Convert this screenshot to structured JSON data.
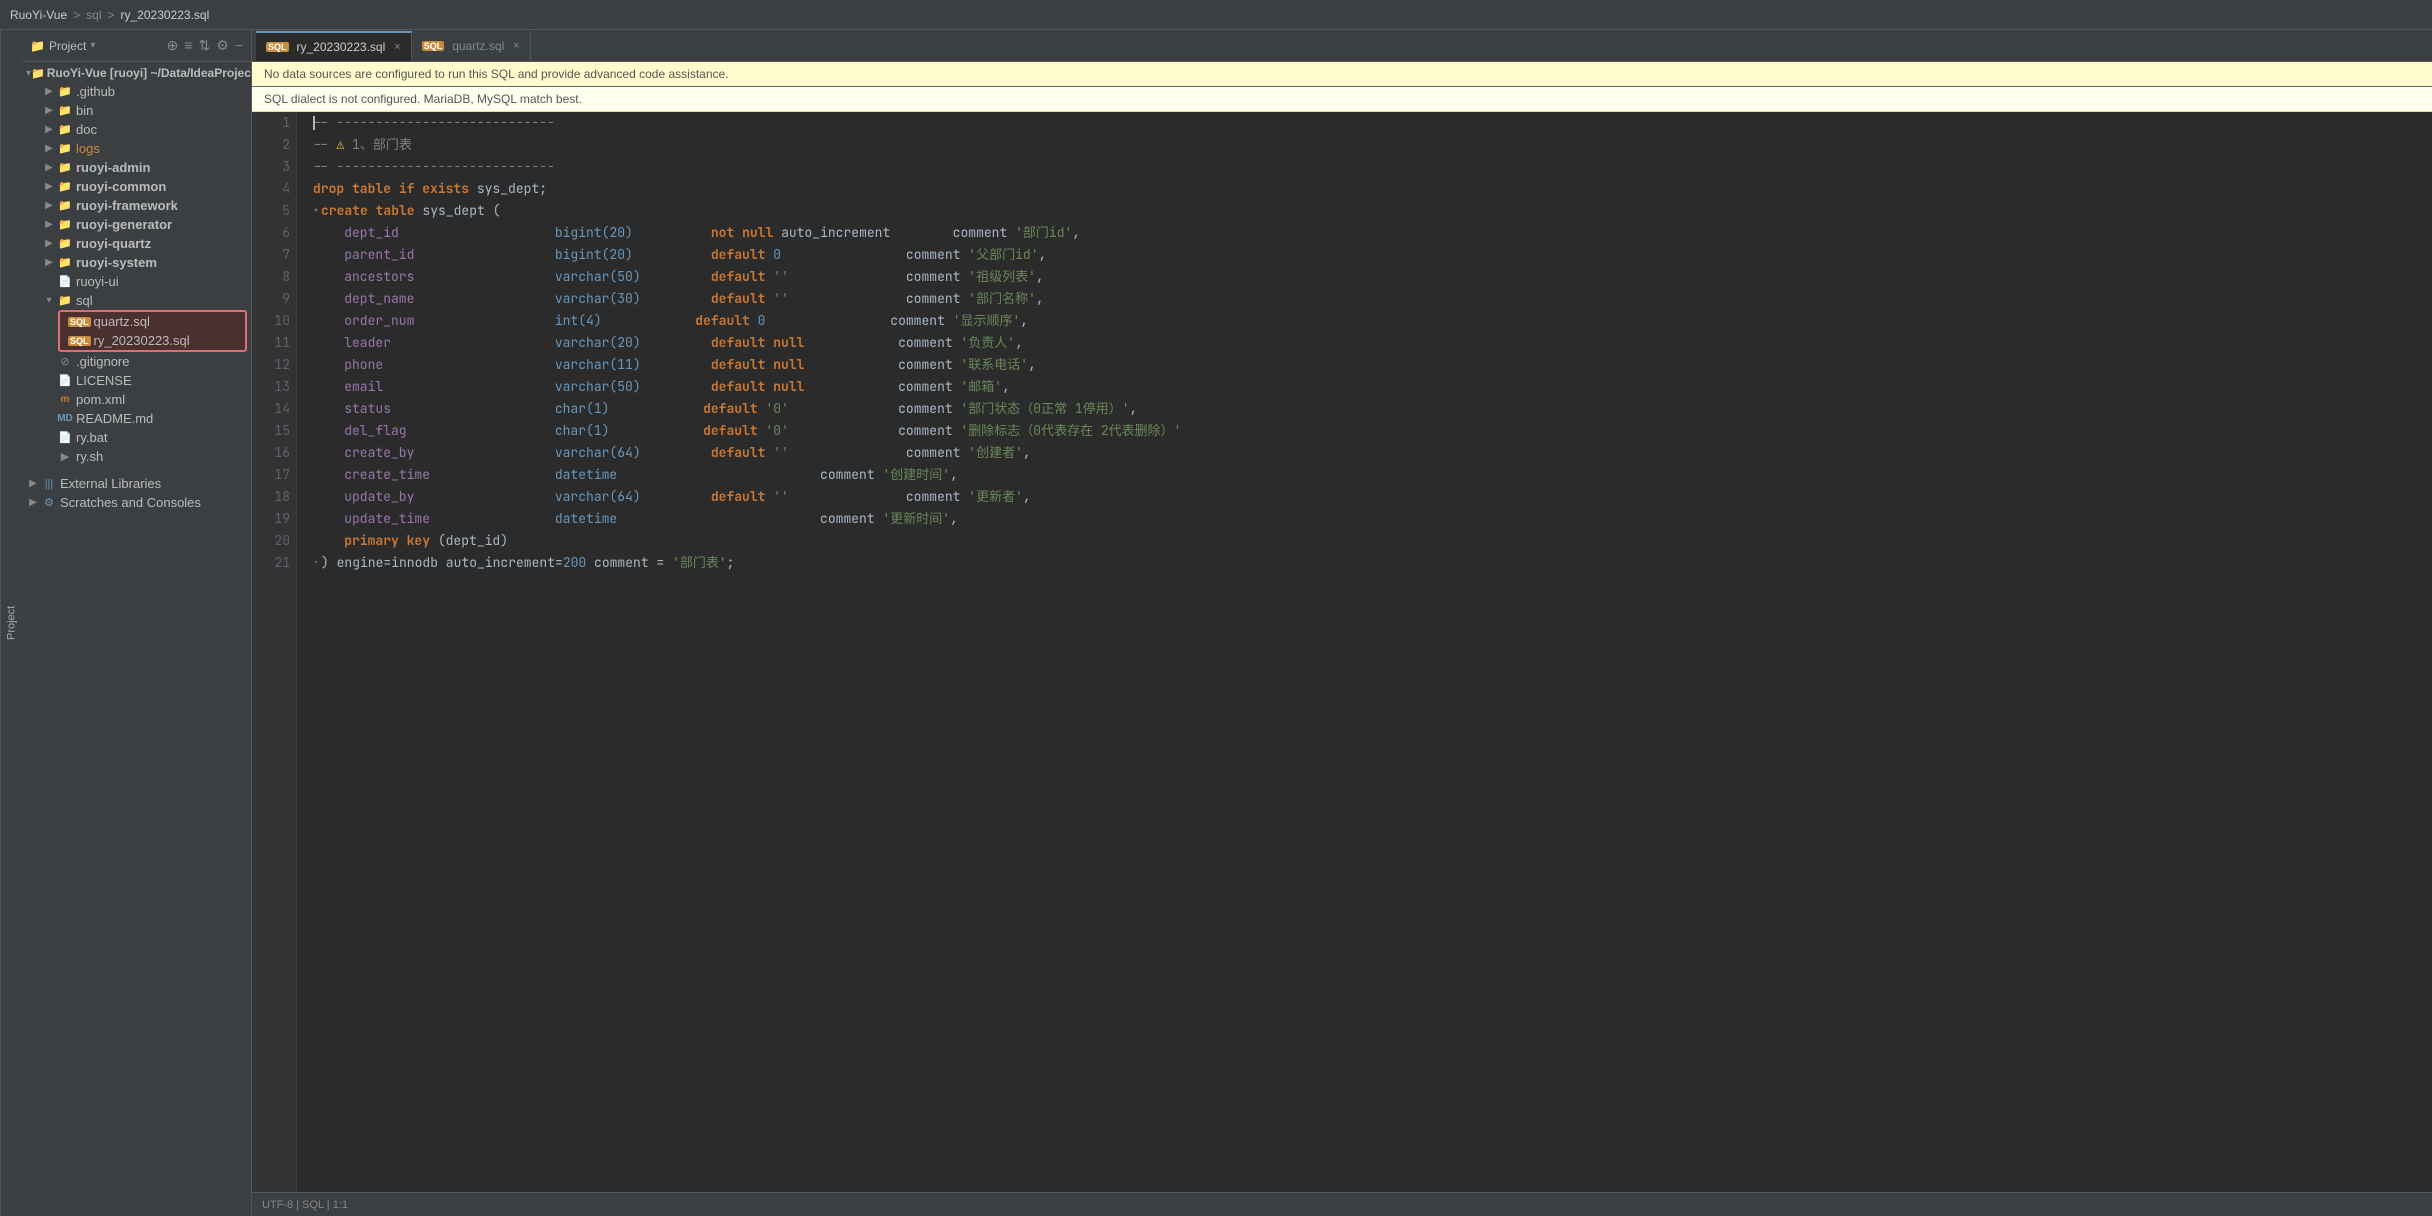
{
  "titlebar": {
    "project": "RuoYi-Vue",
    "sep1": ">",
    "folder": "sql",
    "sep2": ">",
    "file": "ry_20230223.sql"
  },
  "tabs": [
    {
      "id": "ry",
      "label": "ry_20230223.sql",
      "active": true,
      "icon": "SQL"
    },
    {
      "id": "quartz",
      "label": "quartz.sql",
      "active": false,
      "icon": "SQL"
    }
  ],
  "warnings": [
    {
      "id": "datasource",
      "text": "No data sources are configured to run this SQL and provide advanced code assistance."
    },
    {
      "id": "dialect",
      "text": "SQL dialect is not configured. MariaDB, MySQL match best."
    }
  ],
  "sidebar": {
    "title": "Project",
    "root": "RuoYi-Vue [ruoyi] ~/Data/IdeaProjects/RuoYi-V",
    "items": [
      {
        "id": "github",
        "label": ".github",
        "type": "folder",
        "depth": 1,
        "collapsed": true
      },
      {
        "id": "bin",
        "label": "bin",
        "type": "folder",
        "depth": 1,
        "collapsed": true
      },
      {
        "id": "doc",
        "label": "doc",
        "type": "folder",
        "depth": 1,
        "collapsed": true
      },
      {
        "id": "logs",
        "label": "logs",
        "type": "folder",
        "depth": 1,
        "collapsed": true,
        "orange": true
      },
      {
        "id": "ruoyi-admin",
        "label": "ruoyi-admin",
        "type": "folder",
        "depth": 1,
        "collapsed": true,
        "bold": true
      },
      {
        "id": "ruoyi-common",
        "label": "ruoyi-common",
        "type": "folder",
        "depth": 1,
        "collapsed": true,
        "bold": true
      },
      {
        "id": "ruoyi-framework",
        "label": "ruoyi-framework",
        "type": "folder",
        "depth": 1,
        "collapsed": true,
        "bold": true
      },
      {
        "id": "ruoyi-generator",
        "label": "ruoyi-generator",
        "type": "folder",
        "depth": 1,
        "collapsed": true,
        "bold": true
      },
      {
        "id": "ruoyi-quartz",
        "label": "ruoyi-quartz",
        "type": "folder",
        "depth": 1,
        "collapsed": true,
        "bold": true
      },
      {
        "id": "ruoyi-system",
        "label": "ruoyi-system",
        "type": "folder",
        "depth": 1,
        "collapsed": true,
        "bold": true
      },
      {
        "id": "ruoyi-ui",
        "label": "ruoyi-ui",
        "type": "item",
        "depth": 1,
        "collapsed": true
      },
      {
        "id": "sql",
        "label": "sql",
        "type": "folder",
        "depth": 1,
        "collapsed": false
      },
      {
        "id": "quartz-sql",
        "label": "quartz.sql",
        "type": "sql",
        "depth": 2,
        "selected": true
      },
      {
        "id": "ry-sql",
        "label": "ry_20230223.sql",
        "type": "sql",
        "depth": 2,
        "selected": true
      },
      {
        "id": "gitignore",
        "label": ".gitignore",
        "type": "gitignore",
        "depth": 1
      },
      {
        "id": "license",
        "label": "LICENSE",
        "type": "license",
        "depth": 1
      },
      {
        "id": "pom",
        "label": "pom.xml",
        "type": "xml",
        "depth": 1
      },
      {
        "id": "readme",
        "label": "README.md",
        "type": "md",
        "depth": 1
      },
      {
        "id": "ry-bat",
        "label": "ry.bat",
        "type": "bat",
        "depth": 1
      },
      {
        "id": "ry-sh",
        "label": "ry.sh",
        "type": "sh",
        "depth": 1
      }
    ],
    "external_libraries": "External Libraries",
    "scratches": "Scratches and Consoles"
  },
  "code_lines": [
    {
      "num": 1,
      "tokens": [
        {
          "t": "-- ----------------------------",
          "c": "comment"
        }
      ]
    },
    {
      "num": 2,
      "tokens": [
        {
          "t": "-- ",
          "c": "comment"
        },
        {
          "t": "⚠",
          "c": "warn-icon"
        },
        {
          "t": " 1、部门表",
          "c": "comment"
        }
      ]
    },
    {
      "num": 3,
      "tokens": [
        {
          "t": "-- ----------------------------",
          "c": "comment"
        }
      ]
    },
    {
      "num": 4,
      "tokens": [
        {
          "t": "drop table ",
          "c": "kw"
        },
        {
          "t": "if exists ",
          "c": "kw2"
        },
        {
          "t": "sys_dept;",
          "c": "plain"
        }
      ]
    },
    {
      "num": 5,
      "tokens": [
        {
          "t": "create table ",
          "c": "kw"
        },
        {
          "t": "sys_dept (",
          "c": "plain"
        }
      ]
    },
    {
      "num": 6,
      "tokens": [
        {
          "t": "    dept_id",
          "c": "col"
        },
        {
          "t": "                    ",
          "c": "plain"
        },
        {
          "t": "bigint(",
          "c": "type"
        },
        {
          "t": "20",
          "c": "num"
        },
        {
          "t": ")",
          "c": "type"
        },
        {
          "t": "          ",
          "c": "plain"
        },
        {
          "t": "not null ",
          "c": "kw"
        },
        {
          "t": "auto_increment",
          "c": "plain"
        },
        {
          "t": "        comment ",
          "c": "plain"
        },
        {
          "t": "'部门id'",
          "c": "str"
        },
        {
          "t": ",",
          "c": "plain"
        }
      ]
    },
    {
      "num": 7,
      "tokens": [
        {
          "t": "    parent_id",
          "c": "col"
        },
        {
          "t": "                  ",
          "c": "plain"
        },
        {
          "t": "bigint(",
          "c": "type"
        },
        {
          "t": "20",
          "c": "num"
        },
        {
          "t": ")",
          "c": "type"
        },
        {
          "t": "          ",
          "c": "plain"
        },
        {
          "t": "default ",
          "c": "kw"
        },
        {
          "t": "0",
          "c": "num"
        },
        {
          "t": "                ",
          "c": "plain"
        },
        {
          "t": "comment ",
          "c": "plain"
        },
        {
          "t": "'父部门id'",
          "c": "str"
        },
        {
          "t": ",",
          "c": "plain"
        }
      ]
    },
    {
      "num": 8,
      "tokens": [
        {
          "t": "    ancestors",
          "c": "col"
        },
        {
          "t": "                  ",
          "c": "plain"
        },
        {
          "t": "varchar(",
          "c": "type"
        },
        {
          "t": "50",
          "c": "num"
        },
        {
          "t": ")",
          "c": "type"
        },
        {
          "t": "         ",
          "c": "plain"
        },
        {
          "t": "default ",
          "c": "kw"
        },
        {
          "t": "''",
          "c": "str"
        },
        {
          "t": "               ",
          "c": "plain"
        },
        {
          "t": "comment ",
          "c": "plain"
        },
        {
          "t": "'祖级列表'",
          "c": "str"
        },
        {
          "t": ",",
          "c": "plain"
        }
      ]
    },
    {
      "num": 9,
      "tokens": [
        {
          "t": "    dept_name",
          "c": "col"
        },
        {
          "t": "                  ",
          "c": "plain"
        },
        {
          "t": "varchar(",
          "c": "type"
        },
        {
          "t": "30",
          "c": "num"
        },
        {
          "t": ")",
          "c": "type"
        },
        {
          "t": "         ",
          "c": "plain"
        },
        {
          "t": "default ",
          "c": "kw"
        },
        {
          "t": "''",
          "c": "str"
        },
        {
          "t": "               ",
          "c": "plain"
        },
        {
          "t": "comment ",
          "c": "plain"
        },
        {
          "t": "'部门名称'",
          "c": "str"
        },
        {
          "t": ",",
          "c": "plain"
        }
      ]
    },
    {
      "num": 10,
      "tokens": [
        {
          "t": "    order_num",
          "c": "col"
        },
        {
          "t": "                  ",
          "c": "plain"
        },
        {
          "t": "int(",
          "c": "type"
        },
        {
          "t": "4",
          "c": "num"
        },
        {
          "t": ")",
          "c": "type"
        },
        {
          "t": "            ",
          "c": "plain"
        },
        {
          "t": "default ",
          "c": "kw"
        },
        {
          "t": "0",
          "c": "num"
        },
        {
          "t": "                ",
          "c": "plain"
        },
        {
          "t": "comment ",
          "c": "plain"
        },
        {
          "t": "'显示顺序'",
          "c": "str"
        },
        {
          "t": ",",
          "c": "plain"
        }
      ]
    },
    {
      "num": 11,
      "tokens": [
        {
          "t": "    leader",
          "c": "col"
        },
        {
          "t": "                     ",
          "c": "plain"
        },
        {
          "t": "varchar(",
          "c": "type"
        },
        {
          "t": "20",
          "c": "num"
        },
        {
          "t": ")",
          "c": "type"
        },
        {
          "t": "         ",
          "c": "plain"
        },
        {
          "t": "default null",
          "c": "kw"
        },
        {
          "t": "            ",
          "c": "plain"
        },
        {
          "t": "comment ",
          "c": "plain"
        },
        {
          "t": "'负责人'",
          "c": "str"
        },
        {
          "t": ",",
          "c": "plain"
        }
      ]
    },
    {
      "num": 12,
      "tokens": [
        {
          "t": "    phone",
          "c": "col"
        },
        {
          "t": "                      ",
          "c": "plain"
        },
        {
          "t": "varchar(",
          "c": "type"
        },
        {
          "t": "11",
          "c": "num"
        },
        {
          "t": ")",
          "c": "type"
        },
        {
          "t": "         ",
          "c": "plain"
        },
        {
          "t": "default null",
          "c": "kw"
        },
        {
          "t": "            ",
          "c": "plain"
        },
        {
          "t": "comment ",
          "c": "plain"
        },
        {
          "t": "'联系电话'",
          "c": "str"
        },
        {
          "t": ",",
          "c": "plain"
        }
      ]
    },
    {
      "num": 13,
      "tokens": [
        {
          "t": "    email",
          "c": "col"
        },
        {
          "t": "                      ",
          "c": "plain"
        },
        {
          "t": "varchar(",
          "c": "type"
        },
        {
          "t": "50",
          "c": "num"
        },
        {
          "t": ")",
          "c": "type"
        },
        {
          "t": "         ",
          "c": "plain"
        },
        {
          "t": "default null",
          "c": "kw"
        },
        {
          "t": "            ",
          "c": "plain"
        },
        {
          "t": "comment ",
          "c": "plain"
        },
        {
          "t": "'邮箱'",
          "c": "str"
        },
        {
          "t": ",",
          "c": "plain"
        }
      ]
    },
    {
      "num": 14,
      "tokens": [
        {
          "t": "    status",
          "c": "col"
        },
        {
          "t": "                     ",
          "c": "plain"
        },
        {
          "t": "char(",
          "c": "type"
        },
        {
          "t": "1",
          "c": "num"
        },
        {
          "t": ")",
          "c": "type"
        },
        {
          "t": "            ",
          "c": "plain"
        },
        {
          "t": "default ",
          "c": "kw"
        },
        {
          "t": "'0'",
          "c": "str"
        },
        {
          "t": "              ",
          "c": "plain"
        },
        {
          "t": "comment ",
          "c": "plain"
        },
        {
          "t": "'部门状态（0正常 1停用）'",
          "c": "str"
        },
        {
          "t": ",",
          "c": "plain"
        }
      ]
    },
    {
      "num": 15,
      "tokens": [
        {
          "t": "    del_flag",
          "c": "col"
        },
        {
          "t": "                   ",
          "c": "plain"
        },
        {
          "t": "char(",
          "c": "type"
        },
        {
          "t": "1",
          "c": "num"
        },
        {
          "t": ")",
          "c": "type"
        },
        {
          "t": "            ",
          "c": "plain"
        },
        {
          "t": "default ",
          "c": "kw"
        },
        {
          "t": "'0'",
          "c": "str"
        },
        {
          "t": "              ",
          "c": "plain"
        },
        {
          "t": "comment ",
          "c": "plain"
        },
        {
          "t": "'删除标志（0代表存在 2代表删除）'",
          "c": "str"
        }
      ]
    },
    {
      "num": 16,
      "tokens": [
        {
          "t": "    create_by",
          "c": "col"
        },
        {
          "t": "                  ",
          "c": "plain"
        },
        {
          "t": "varchar(",
          "c": "type"
        },
        {
          "t": "64",
          "c": "num"
        },
        {
          "t": ")",
          "c": "type"
        },
        {
          "t": "         ",
          "c": "plain"
        },
        {
          "t": "default ",
          "c": "kw"
        },
        {
          "t": "''",
          "c": "str"
        },
        {
          "t": "               ",
          "c": "plain"
        },
        {
          "t": "comment ",
          "c": "plain"
        },
        {
          "t": "'创建者'",
          "c": "str"
        },
        {
          "t": ",",
          "c": "plain"
        }
      ]
    },
    {
      "num": 17,
      "tokens": [
        {
          "t": "    create_time",
          "c": "col"
        },
        {
          "t": "                ",
          "c": "plain"
        },
        {
          "t": "datetime",
          "c": "type"
        },
        {
          "t": "                          ",
          "c": "plain"
        },
        {
          "t": "comment ",
          "c": "plain"
        },
        {
          "t": "'创建时间'",
          "c": "str"
        },
        {
          "t": ",",
          "c": "plain"
        }
      ]
    },
    {
      "num": 18,
      "tokens": [
        {
          "t": "    update_by",
          "c": "col"
        },
        {
          "t": "                  ",
          "c": "plain"
        },
        {
          "t": "varchar(",
          "c": "type"
        },
        {
          "t": "64",
          "c": "num"
        },
        {
          "t": ")",
          "c": "type"
        },
        {
          "t": "         ",
          "c": "plain"
        },
        {
          "t": "default ",
          "c": "kw"
        },
        {
          "t": "''",
          "c": "str"
        },
        {
          "t": "               ",
          "c": "plain"
        },
        {
          "t": "comment ",
          "c": "plain"
        },
        {
          "t": "'更新者'",
          "c": "str"
        },
        {
          "t": ",",
          "c": "plain"
        }
      ]
    },
    {
      "num": 19,
      "tokens": [
        {
          "t": "    update_time",
          "c": "col"
        },
        {
          "t": "                ",
          "c": "plain"
        },
        {
          "t": "datetime",
          "c": "type"
        },
        {
          "t": "                          ",
          "c": "plain"
        },
        {
          "t": "comment ",
          "c": "plain"
        },
        {
          "t": "'更新时间'",
          "c": "str"
        },
        {
          "t": ",",
          "c": "plain"
        }
      ]
    },
    {
      "num": 20,
      "tokens": [
        {
          "t": "    ",
          "c": "plain"
        },
        {
          "t": "primary key ",
          "c": "kw"
        },
        {
          "t": "(dept_id)",
          "c": "plain"
        }
      ]
    },
    {
      "num": 21,
      "tokens": [
        {
          "t": ") engine=innodb auto_increment=",
          "c": "plain"
        },
        {
          "t": "200",
          "c": "num"
        },
        {
          "t": " comment = ",
          "c": "plain"
        },
        {
          "t": "'部门表'",
          "c": "str"
        },
        {
          "t": ";",
          "c": "plain"
        }
      ]
    }
  ],
  "colors": {
    "accent_blue": "#6897bb",
    "accent_orange": "#cc7832",
    "accent_green": "#6a8759",
    "accent_purple": "#9876aa",
    "warning_yellow_bg": "#fffbcc",
    "selected_border": "#e06c75"
  }
}
